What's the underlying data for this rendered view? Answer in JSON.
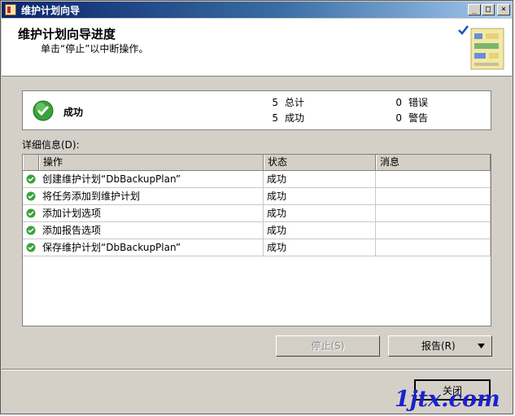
{
  "window": {
    "title": "维护计划向导"
  },
  "title_buttons": {
    "minimize": "_",
    "maximize": "□",
    "close": "×"
  },
  "header": {
    "title": "维护计划向导进度",
    "subtitle": "单击“停止”以中断操作。"
  },
  "summary": {
    "status": "成功",
    "total_count": "5",
    "total_label": "总计",
    "success_count": "5",
    "success_label": "成功",
    "error_count": "0",
    "error_label": "错误",
    "warning_count": "0",
    "warning_label": "警告"
  },
  "details_label": "详细信息(D):",
  "grid": {
    "columns": [
      "操作",
      "状态",
      "消息"
    ],
    "rows": [
      {
        "action": "创建维护计划“DbBackupPlan”",
        "status": "成功",
        "message": ""
      },
      {
        "action": "将任务添加到维护计划",
        "status": "成功",
        "message": ""
      },
      {
        "action": "添加计划选项",
        "status": "成功",
        "message": ""
      },
      {
        "action": "添加报告选项",
        "status": "成功",
        "message": ""
      },
      {
        "action": "保存维护计划“DbBackupPlan”",
        "status": "成功",
        "message": ""
      }
    ]
  },
  "buttons": {
    "stop": "停止(S)",
    "report": "报告(R)",
    "close": "关闭"
  },
  "watermark": "1jtx.com",
  "icons": {
    "success": "check-circle-icon",
    "dropdown": "triangle-down-icon"
  },
  "colors": {
    "titlebar": "#0a246a",
    "success": "#3aa23a",
    "watermark": "#1a23c8"
  }
}
